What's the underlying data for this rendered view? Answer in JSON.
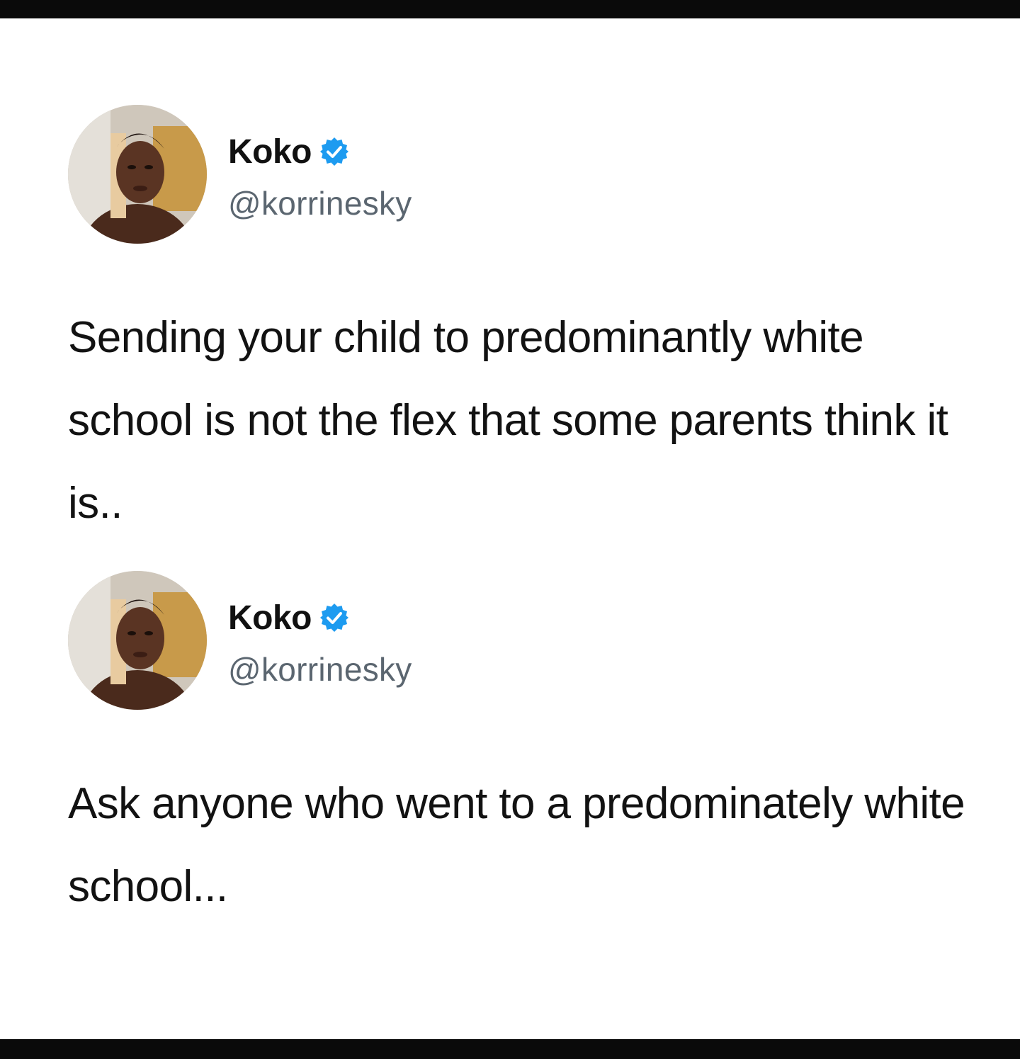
{
  "tweets": [
    {
      "author": {
        "display_name": "Koko",
        "handle": "@korrinesky",
        "verified": true,
        "verified_color": "#1d9bf0"
      },
      "text": "Sending your child to predominantly white school is not the flex that some parents think it is.."
    },
    {
      "author": {
        "display_name": "Koko",
        "handle": "@korrinesky",
        "verified": true,
        "verified_color": "#1d9bf0"
      },
      "text": "Ask anyone who went to a predominately white school..."
    }
  ],
  "icons": {
    "verified": "verified-badge-icon",
    "avatar": "profile-photo"
  }
}
